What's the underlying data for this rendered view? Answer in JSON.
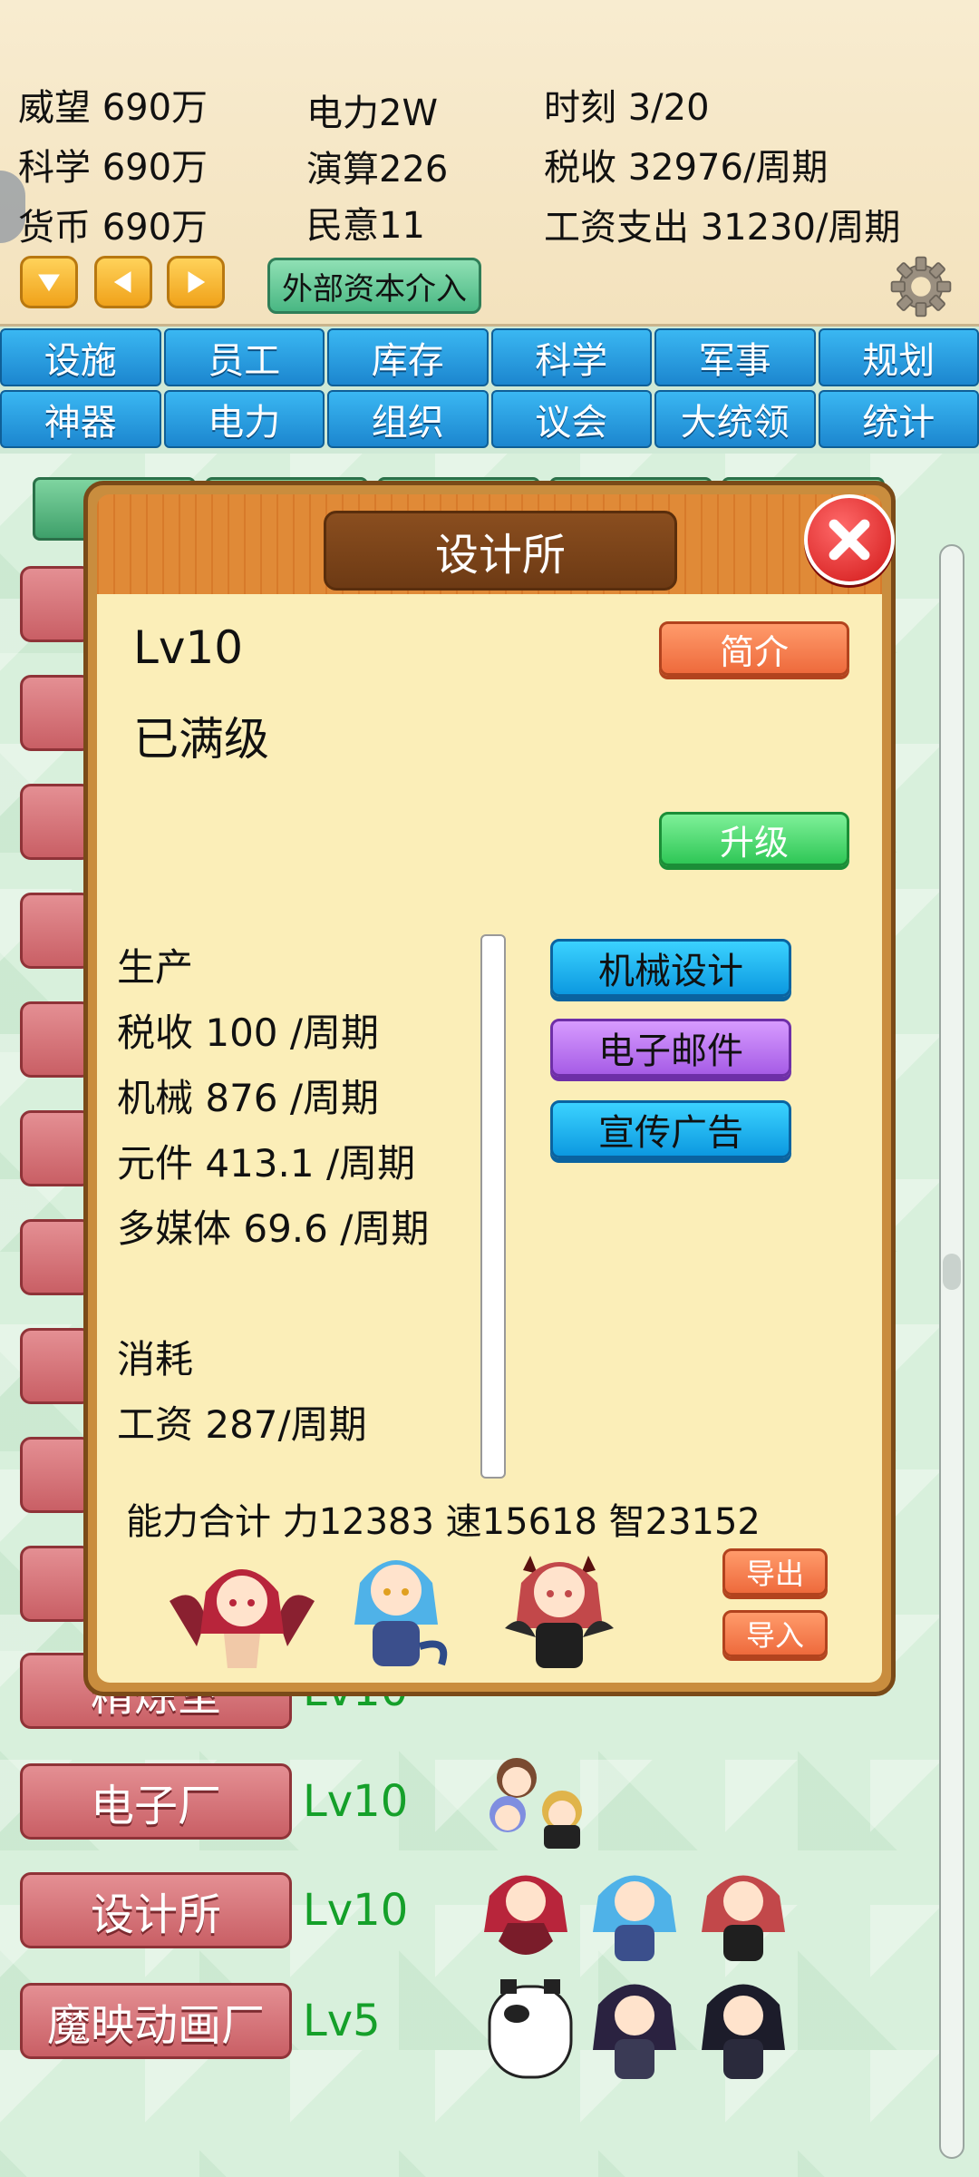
{
  "stats": {
    "prestige": "威望 690万",
    "science": "科学 690万",
    "currency": "货币 690万",
    "power": "电力2W",
    "compute": "演算226",
    "public_opinion": "民意11",
    "time": "时刻 3/20",
    "tax": "税收 32976/周期",
    "wages": "工资支出 31230/周期"
  },
  "toolbar": {
    "external_capital_label": "外部资本介入"
  },
  "tabs": [
    "设施",
    "员工",
    "库存",
    "科学",
    "军事",
    "规划",
    "神器",
    "电力",
    "组织",
    "议会",
    "大统领",
    "统计"
  ],
  "buildings": [
    {
      "name": "精炼室",
      "level": "Lv10"
    },
    {
      "name": "电子厂",
      "level": "Lv10"
    },
    {
      "name": "设计所",
      "level": "Lv10"
    },
    {
      "name": "魔映动画厂",
      "level": "Lv5"
    }
  ],
  "modal": {
    "title": "设计所",
    "level": "Lv10",
    "max_level_text": "已满级",
    "intro_label": "简介",
    "upgrade_label": "升级",
    "production_title": "生产",
    "production": [
      "税收 100 /周期",
      "机械 876 /周期",
      "元件 413.1 /周期",
      "多媒体 69.6 /周期"
    ],
    "consumption_title": "消耗",
    "consumption": [
      "工资 287/周期"
    ],
    "actions": [
      "机械设计",
      "电子邮件",
      "宣传广告"
    ],
    "ability_total": "能力合计 力12383 速15618 智23152",
    "export_label": "导出",
    "import_label": "导入"
  },
  "colors": {
    "tab_blue": "#1c86cf",
    "building_pink": "#c95f65",
    "level_green": "#15a02a",
    "modal_bg": "#fbeeb8"
  },
  "icons": [
    "arrow-down-icon",
    "arrow-left-icon",
    "arrow-right-icon",
    "gear-icon",
    "close-icon"
  ]
}
